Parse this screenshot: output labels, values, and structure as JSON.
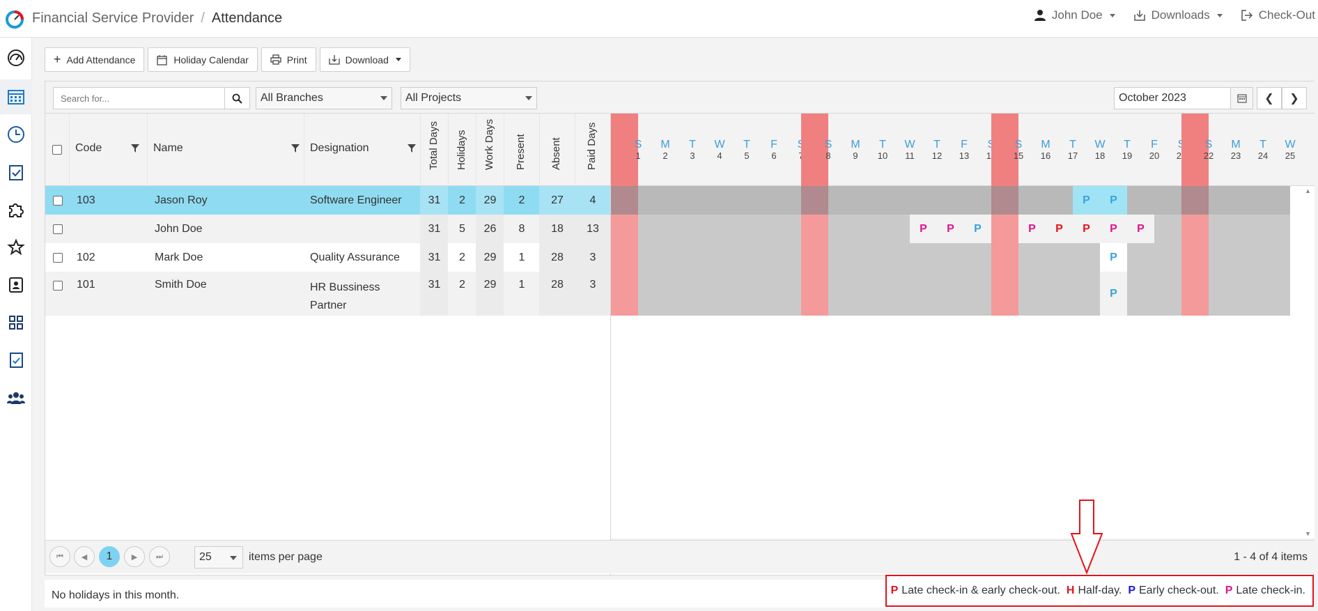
{
  "app": {
    "title": "Financial Service Provider",
    "page": "Attendance"
  },
  "topnav": {
    "user": "John Doe",
    "downloads": "Downloads",
    "checkout": "Check-Out"
  },
  "toolbar": {
    "add": "Add Attendance",
    "holiday": "Holiday Calendar",
    "print": "Print",
    "download": "Download"
  },
  "filters": {
    "search_placeholder": "Search for...",
    "branch": "All Branches",
    "project": "All Projects",
    "month": "October 2023"
  },
  "columns": {
    "code": "Code",
    "name": "Name",
    "designation": "Designation",
    "total": "Total Days",
    "holidays": "Holidays",
    "work": "Work Days",
    "present": "Present",
    "absent": "Absent",
    "paid": "Paid Days"
  },
  "rows": [
    {
      "code": "103",
      "name": "Jason Roy",
      "designation": "Software Engineer",
      "total": "31",
      "holidays": "2",
      "work": "29",
      "present": "2",
      "absent": "27",
      "paid": "4"
    },
    {
      "code": "",
      "name": "John Doe",
      "designation": "",
      "total": "31",
      "holidays": "5",
      "work": "26",
      "present": "8",
      "absent": "18",
      "paid": "13"
    },
    {
      "code": "102",
      "name": "Mark Doe",
      "designation": "Quality Assurance",
      "total": "31",
      "holidays": "2",
      "work": "29",
      "present": "1",
      "absent": "28",
      "paid": "3"
    },
    {
      "code": "101",
      "name": "Smith Doe",
      "designation": "HR Bussiness Partner",
      "total": "31",
      "holidays": "2",
      "work": "29",
      "present": "1",
      "absent": "28",
      "paid": "3"
    }
  ],
  "days": [
    {
      "l": "S",
      "d": "1"
    },
    {
      "l": "M",
      "d": "2"
    },
    {
      "l": "T",
      "d": "3"
    },
    {
      "l": "W",
      "d": "4"
    },
    {
      "l": "T",
      "d": "5"
    },
    {
      "l": "F",
      "d": "6"
    },
    {
      "l": "S",
      "d": "7"
    },
    {
      "l": "S",
      "d": "8"
    },
    {
      "l": "M",
      "d": "9"
    },
    {
      "l": "T",
      "d": "10"
    },
    {
      "l": "W",
      "d": "11"
    },
    {
      "l": "T",
      "d": "12"
    },
    {
      "l": "F",
      "d": "13"
    },
    {
      "l": "S",
      "d": "14"
    },
    {
      "l": "S",
      "d": "15"
    },
    {
      "l": "M",
      "d": "16"
    },
    {
      "l": "T",
      "d": "17"
    },
    {
      "l": "W",
      "d": "18"
    },
    {
      "l": "T",
      "d": "19"
    },
    {
      "l": "F",
      "d": "20"
    },
    {
      "l": "S",
      "d": "21"
    },
    {
      "l": "S",
      "d": "22"
    },
    {
      "l": "M",
      "d": "23"
    },
    {
      "l": "T",
      "d": "24"
    },
    {
      "l": "W",
      "d": "25"
    }
  ],
  "sundays": [
    "1",
    "8",
    "15",
    "22"
  ],
  "marks": [
    {
      "row": 0,
      "day": "18",
      "v": "P",
      "c": "#3aa3d9",
      "bg": "#9fe3f5"
    },
    {
      "row": 0,
      "day": "19",
      "v": "P",
      "c": "#3aa3d9",
      "bg": "#9fe3f5"
    },
    {
      "row": 1,
      "day": "12",
      "v": "P",
      "c": "#e0148c",
      "bg": "#f2f2f2"
    },
    {
      "row": 1,
      "day": "13",
      "v": "P",
      "c": "#e0148c",
      "bg": "#f2f2f2"
    },
    {
      "row": 1,
      "day": "14",
      "v": "P",
      "c": "#3aa3d9",
      "bg": "#f2f2f2"
    },
    {
      "row": 1,
      "day": "16",
      "v": "P",
      "c": "#e0148c",
      "bg": "#f2f2f2"
    },
    {
      "row": 1,
      "day": "17",
      "v": "P",
      "c": "#e3131a",
      "bg": "#f2f2f2"
    },
    {
      "row": 1,
      "day": "18",
      "v": "P",
      "c": "#e3131a",
      "bg": "#f2f2f2"
    },
    {
      "row": 1,
      "day": "19",
      "v": "P",
      "c": "#e0148c",
      "bg": "#f2f2f2"
    },
    {
      "row": 1,
      "day": "20",
      "v": "P",
      "c": "#e0148c",
      "bg": "#f2f2f2"
    },
    {
      "row": 2,
      "day": "19",
      "v": "P",
      "c": "#3aa3d9",
      "bg": "#ffffff"
    },
    {
      "row": 3,
      "day": "19",
      "v": "P",
      "c": "#3aa3d9",
      "bg": "#f2f2f2"
    }
  ],
  "pager": {
    "page": "1",
    "size": "25",
    "per_page": "items per page",
    "range": "1 - 4 of 4 items"
  },
  "footer": {
    "holidays_msg": "No holidays in this month."
  },
  "legend": [
    {
      "k": "P",
      "t": "Late check-in & early check-out.",
      "c": "#e3131a"
    },
    {
      "k": "H",
      "t": "Half-day.",
      "c": "#e3131a"
    },
    {
      "k": "P",
      "t": "Early check-out.",
      "c": "#1a1adb"
    },
    {
      "k": "P",
      "t": "Late check-in.",
      "c": "#e0148c"
    }
  ],
  "colors": {
    "accent": "#3a9fd6",
    "selected_row": "#8fdcf2",
    "sunday": "#f08080",
    "absent_cell": "#c9c9c9"
  }
}
